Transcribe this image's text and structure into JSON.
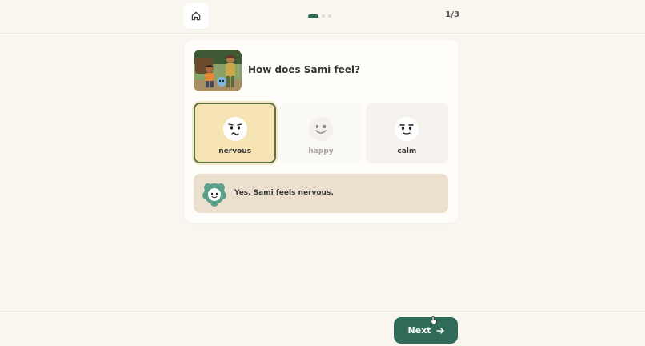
{
  "header": {
    "home_icon": "home-icon",
    "progress": {
      "current": 1,
      "total": 3
    },
    "step_counter": "1/3"
  },
  "question": {
    "image_icon": "story-illustration",
    "text": "How does Sami feel?"
  },
  "options": [
    {
      "label": "nervous",
      "state": "selected"
    },
    {
      "label": "happy",
      "state": "faded"
    },
    {
      "label": "calm",
      "state": "default"
    }
  ],
  "feedback": {
    "icon": "mascot-icon",
    "text": "Yes. Sami feels nervous."
  },
  "footer": {
    "next_label": "Next",
    "next_icon": "arrow-right-icon"
  },
  "colors": {
    "accent": "#2f6b58",
    "selected_bg": "#f6e4b5",
    "feedback_bg": "#ebdfcd",
    "page_bg": "#f9f6f0"
  }
}
